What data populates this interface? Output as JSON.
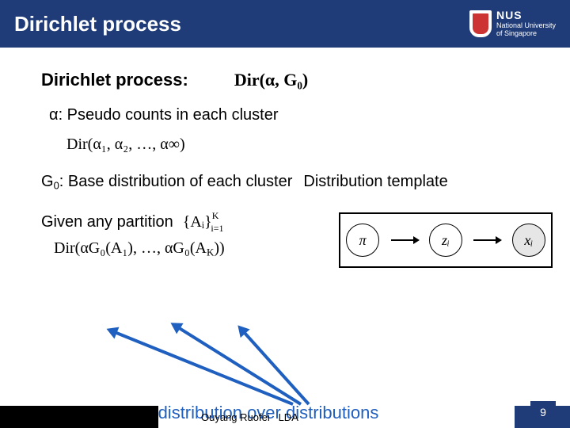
{
  "header": {
    "title": "Dirichlet process",
    "logo": {
      "acronym": "NUS",
      "fullname": "National University\nof Singapore"
    }
  },
  "body": {
    "heading": "Dirichlet process:",
    "dp_formula": "Dir(α, G₀)",
    "alpha_desc": "α: Pseudo counts in each cluster",
    "alpha_formula": "Dir(α₁, α₂, …, α∞)",
    "g0_desc": "G",
    "g0_sub": "0",
    "g0_after": ": Base distribution of each cluster",
    "g0_note": "Distribution template",
    "given_label": "Given any partition",
    "partition_set": "{Aᵢ}",
    "partition_sup": "K",
    "partition_sub": "i=1",
    "big_formula": "Dir(αG₀(A₁), …, αG₀(A",
    "big_formula_k": "K",
    "big_formula_tail": "))",
    "tagline": "A distribution over distributions",
    "pgm": {
      "n1": "π",
      "n2": "zᵢ",
      "n3": "xᵢ"
    }
  },
  "footer": {
    "author": "Ouyang Ruofei",
    "topic": "LDA",
    "page": "9"
  }
}
